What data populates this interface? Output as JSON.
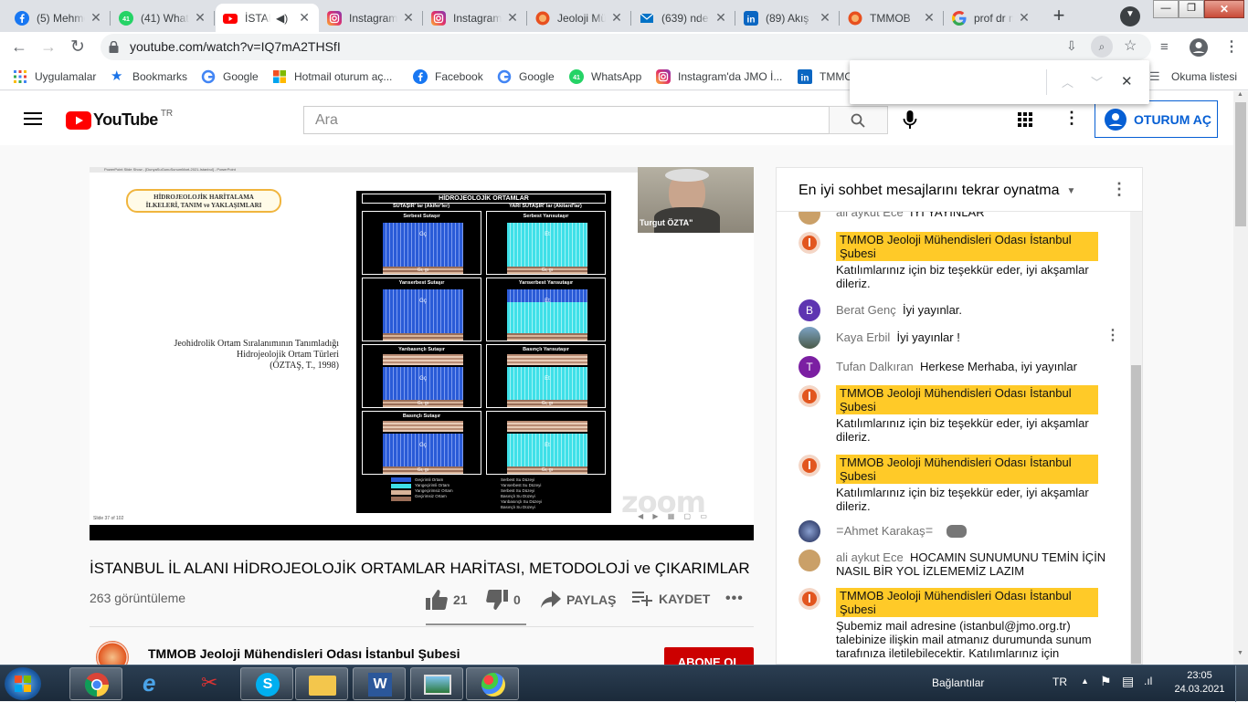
{
  "tabs": [
    {
      "label": "(5) Mehme",
      "icon": "facebook-icon"
    },
    {
      "label": "(41) What",
      "icon": "whatsapp-icon"
    },
    {
      "label": "İSTAN",
      "icon": "youtube-icon",
      "active": true
    },
    {
      "label": "Instagram",
      "icon": "instagram-icon"
    },
    {
      "label": "Instagram",
      "icon": "instagram-icon"
    },
    {
      "label": "Jeoloji Mü",
      "icon": "jmo-icon"
    },
    {
      "label": "(639) nde",
      "icon": "mail-icon"
    },
    {
      "label": "(89) Akış",
      "icon": "linkedin-icon"
    },
    {
      "label": "TMMOB",
      "icon": "jmo-icon"
    },
    {
      "label": "prof dr m",
      "icon": "google-icon"
    }
  ],
  "toolbar": {
    "url": "youtube.com/watch?v=IQ7mA2THSfI"
  },
  "bookmarks": [
    {
      "label": "Uygulamalar",
      "icon": "apps-grid-icon"
    },
    {
      "label": "Bookmarks",
      "icon": "star-icon"
    },
    {
      "label": "Google",
      "icon": "google-icon"
    },
    {
      "label": "Hotmail oturum aç...",
      "icon": "windows-icon"
    },
    {
      "label": "Facebook",
      "icon": "facebook-icon"
    },
    {
      "label": "Google",
      "icon": "google-icon"
    },
    {
      "label": "WhatsApp",
      "icon": "whatsapp-icon"
    },
    {
      "label": "Instagram'da JMO İ...",
      "icon": "instagram-icon"
    },
    {
      "label": "TMMO",
      "icon": "linkedin-icon"
    }
  ],
  "reading_list": "Okuma listesi",
  "youtube": {
    "logo_text": "YouTube",
    "region": "TR",
    "search_placeholder": "Ara",
    "signin_label": "OTURUM AÇ"
  },
  "video": {
    "title": "İSTANBUL İL ALANI HİDROJEOLOJİK ORTAMLAR HARİTASI, METODOLOJİ ve ÇIKARIMLAR",
    "views": "263 görüntüleme",
    "likes": "21",
    "dislikes": "0",
    "share_label": "PAYLAŞ",
    "save_label": "KAYDET",
    "channel_name": "TMMOB Jeoloji Mühendisleri Odası İstanbul Şubesi",
    "subscribe_label": "ABONE OL",
    "speaker_name": "Turgut ÖZTA",
    "zoom_watermark": "zoom",
    "slide": {
      "window_title": "PowerPoint Slide Show - [DunyaSuGunuSunumMart-2021-Istanbul] - PowerPoint",
      "badge_line1": "HİDROJEOLOJİK HARİTALAMA",
      "badge_line2": "İLKELERİ, TANIM ve YAKLAŞIMLARI",
      "caption_line1": "Jeohidrolik Ortam Sıralanımının Tanımladığı",
      "caption_line2": "Hidrojeolojik Ortam Türleri",
      "caption_line3": "(ÖZTAŞ, T., 1998)",
      "panel_title": "HİDROJEOLOJİK ORTAMLAR",
      "col_left": "SUTAŞIR' lar (Akifer'ler)",
      "col_right": "YARI SUTAŞIR' lar (Akitard'lar)",
      "cells": [
        {
          "title": "Serbest Sutaşır",
          "label": "Gç",
          "bottom": "Gı, gı",
          "color": "blue"
        },
        {
          "title": "Serbest Yarısutaşır",
          "label": "Et",
          "bottom": "Gı, gı",
          "color": "cyan"
        },
        {
          "title": "Yarıserbest Sutaşır",
          "label": "Gç",
          "bottom": "",
          "color": "blue"
        },
        {
          "title": "Yarıserbest Yarısutaşır",
          "label": "Et",
          "bottom": "",
          "color": "mix"
        },
        {
          "title": "Yarıbasınçlı Sutaşır",
          "label": "Gç",
          "bottom": "Gı, gı",
          "color": "blue"
        },
        {
          "title": "Basınçlı Yarısutaşır",
          "label": "Et",
          "bottom": "Gı, gı",
          "color": "cyan"
        },
        {
          "title": "Basınçlı Sutaşır",
          "label": "Gç",
          "bottom": "Gı, gı",
          "color": "blue"
        },
        {
          "title": "",
          "label": "Et",
          "bottom": "Gı, gı",
          "color": "cyan"
        }
      ],
      "legend_left": [
        "Geçirimli Ortam",
        "Yarıgeçirimli Ortam",
        "Yarıgeçirimsiz Ortam",
        "Geçirimsiz Ortam"
      ],
      "legend_right": [
        "Serbest Su Düzeyi",
        "Yarıserbest Su Düzeyi",
        "Serbest Su Düzeyi",
        "Basınçlı Su Düzeyi",
        "Yarıbasınçlı Su Düzeyi",
        "Basınçlı Su Düzeyi"
      ],
      "slide_number": "Slide 37 of 102"
    }
  },
  "chat": {
    "header": "En iyi sohbet mesajlarını tekrar oynatma",
    "messages": [
      {
        "kind": "normal",
        "author": "ali aykut Ece",
        "text": "İYİ YAYINLAR"
      },
      {
        "kind": "paid",
        "author": "TMMOB Jeoloji Mühendisleri Odası İstanbul Şubesi",
        "text": "Katılımlarınız için biz teşekkür eder, iyi akşamlar dileriz."
      },
      {
        "kind": "normal",
        "author": "Berat Genç",
        "text": "İyi yayınlar.",
        "initial": "B",
        "color": "#5e35b1"
      },
      {
        "kind": "normal",
        "author": "Kaya Erbil",
        "text": "İyi yayınlar !"
      },
      {
        "kind": "normal",
        "author": "Tufan Dalkıran",
        "text": "Herkese Merhaba, iyi yayınlar",
        "initial": "T",
        "color": "#7b1fa2"
      },
      {
        "kind": "paid",
        "author": "TMMOB Jeoloji Mühendisleri Odası İstanbul Şubesi",
        "text": "Katılımlarınız için biz teşekkür eder, iyi akşamlar dileriz."
      },
      {
        "kind": "paid",
        "author": "TMMOB Jeoloji Mühendisleri Odası İstanbul Şubesi",
        "text": "Katılımlarınız için biz teşekkür eder, iyi akşamlar dileriz."
      },
      {
        "kind": "normal",
        "author": "ꘌAhmet Karakaşꘌ",
        "text": ""
      },
      {
        "kind": "normal",
        "author": "ali aykut Ece",
        "text": "HOCAMIN SUNUMUNU TEMİN İÇİN NASIL BİR YOL İZLEMEMİZ LAZIM"
      },
      {
        "kind": "paid",
        "author": "TMMOB Jeoloji Mühendisleri Odası İstanbul Şubesi",
        "text": "Şubemiz mail adresine (istanbul@jmo.org.tr) talebinize ilişkin mail atmanız durumunda sunum tarafınıza iletilebilecektir. Katılımlarınız için"
      }
    ]
  },
  "taskbar": {
    "connections": "Bağlantılar",
    "lang": "TR",
    "time": "23:05",
    "date": "24.03.2021"
  }
}
